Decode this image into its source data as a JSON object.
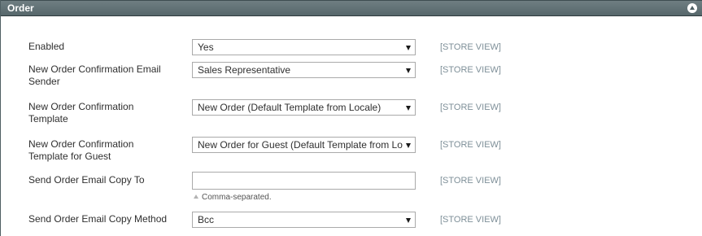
{
  "section": {
    "title": "Order",
    "collapse_icon": "chevron-up-icon"
  },
  "fields": [
    {
      "label": "Enabled",
      "value": "Yes",
      "scope": "[STORE VIEW]"
    },
    {
      "label": "New Order Confirmation Email Sender",
      "value": "Sales Representative",
      "scope": "[STORE VIEW]"
    },
    {
      "label": "New Order Confirmation Template",
      "value": "New Order (Default Template from Locale)",
      "scope": "[STORE VIEW]"
    },
    {
      "label": "New Order Confirmation Template for Guest",
      "value": "New Order for Guest (Default Template from Lo",
      "scope": "[STORE VIEW]"
    },
    {
      "label": "Send Order Email Copy To",
      "value": "",
      "scope": "[STORE VIEW]",
      "note": "Comma-separated."
    },
    {
      "label": "Send Order Email Copy Method",
      "value": "Bcc",
      "scope": "[STORE VIEW]"
    }
  ]
}
